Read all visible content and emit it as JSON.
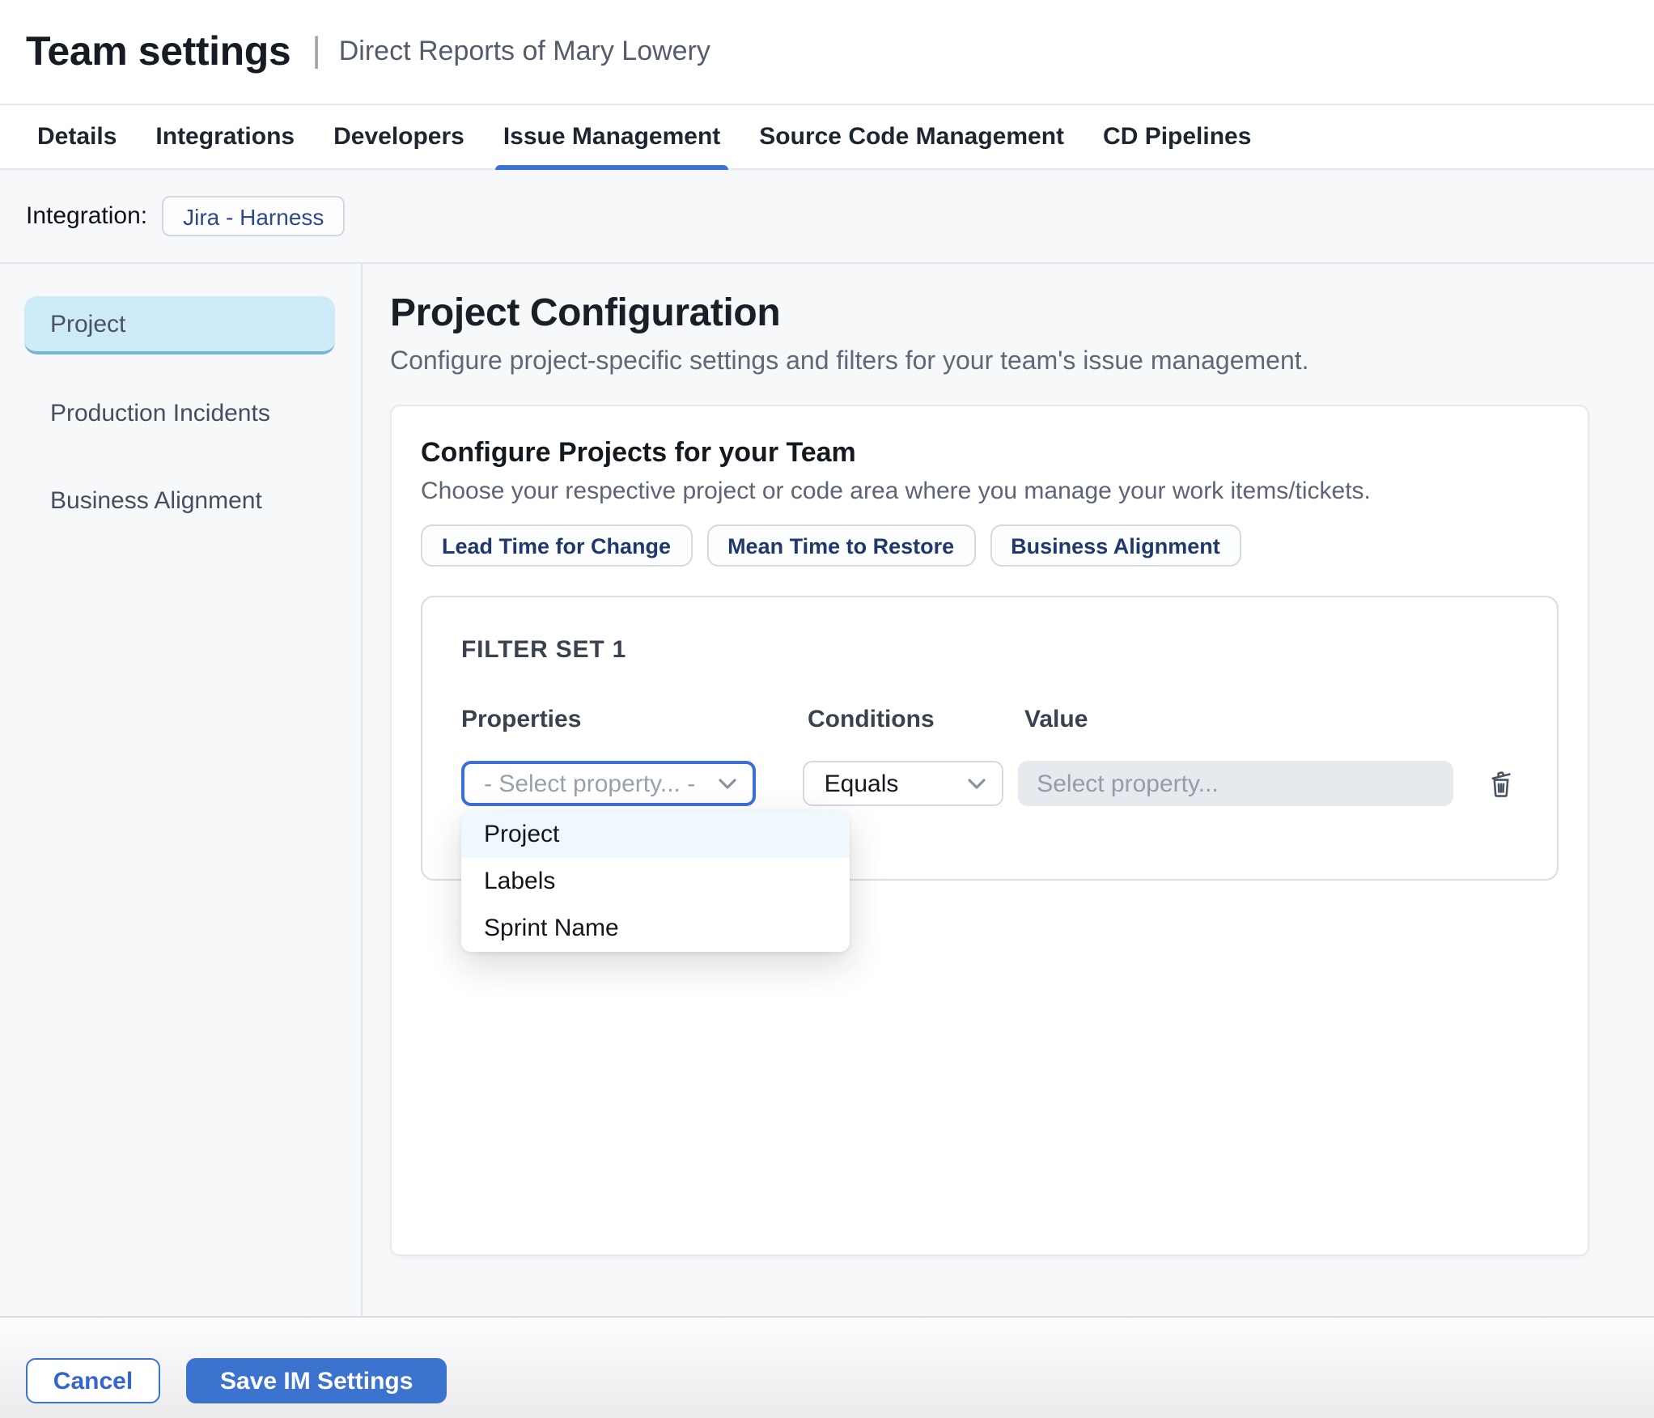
{
  "header": {
    "title": "Team settings",
    "separator": "|",
    "subtitle": "Direct Reports of Mary Lowery"
  },
  "tabs": {
    "items": [
      {
        "label": "Details",
        "active": false
      },
      {
        "label": "Integrations",
        "active": false
      },
      {
        "label": "Developers",
        "active": false
      },
      {
        "label": "Issue Management",
        "active": true
      },
      {
        "label": "Source Code Management",
        "active": false
      },
      {
        "label": "CD Pipelines",
        "active": false
      }
    ]
  },
  "integration": {
    "label": "Integration:",
    "chip": "Jira - Harness"
  },
  "sidebar": {
    "items": [
      {
        "label": "Project",
        "active": true
      },
      {
        "label": "Production Incidents",
        "active": false
      },
      {
        "label": "Business Alignment",
        "active": false
      }
    ]
  },
  "main": {
    "title": "Project Configuration",
    "description": "Configure project-specific settings and filters for your team's issue management.",
    "card": {
      "title": "Configure Projects for your Team",
      "subtitle": "Choose your respective project or code area where you manage your work items/tickets.",
      "chips": [
        "Lead Time for Change",
        "Mean Time to Restore",
        "Business Alignment"
      ],
      "filter_set": {
        "title": "FILTER SET 1",
        "columns": [
          "Properties",
          "Conditions",
          "Value"
        ],
        "property_placeholder": "- Select property... -",
        "condition_value": "Equals",
        "value_placeholder": "Select property...",
        "dropdown_options": [
          {
            "label": "Project",
            "highlighted": true
          },
          {
            "label": "Labels",
            "highlighted": false
          },
          {
            "label": "Sprint Name",
            "highlighted": false
          }
        ]
      }
    }
  },
  "footer": {
    "cancel_label": "Cancel",
    "save_label": "Save IM Settings"
  },
  "colors": {
    "primary_blue": "#3b72d3",
    "save_button": "#3b73cf",
    "active_sidebar_bg": "#cdecf7",
    "active_sidebar_border": "#76b5d6",
    "dropdown_highlight": "#eff8fc",
    "navy_chip_text": "#20386b",
    "content_bg": "#f7f8fa",
    "disabled_field_bg": "#e6e9ee"
  }
}
